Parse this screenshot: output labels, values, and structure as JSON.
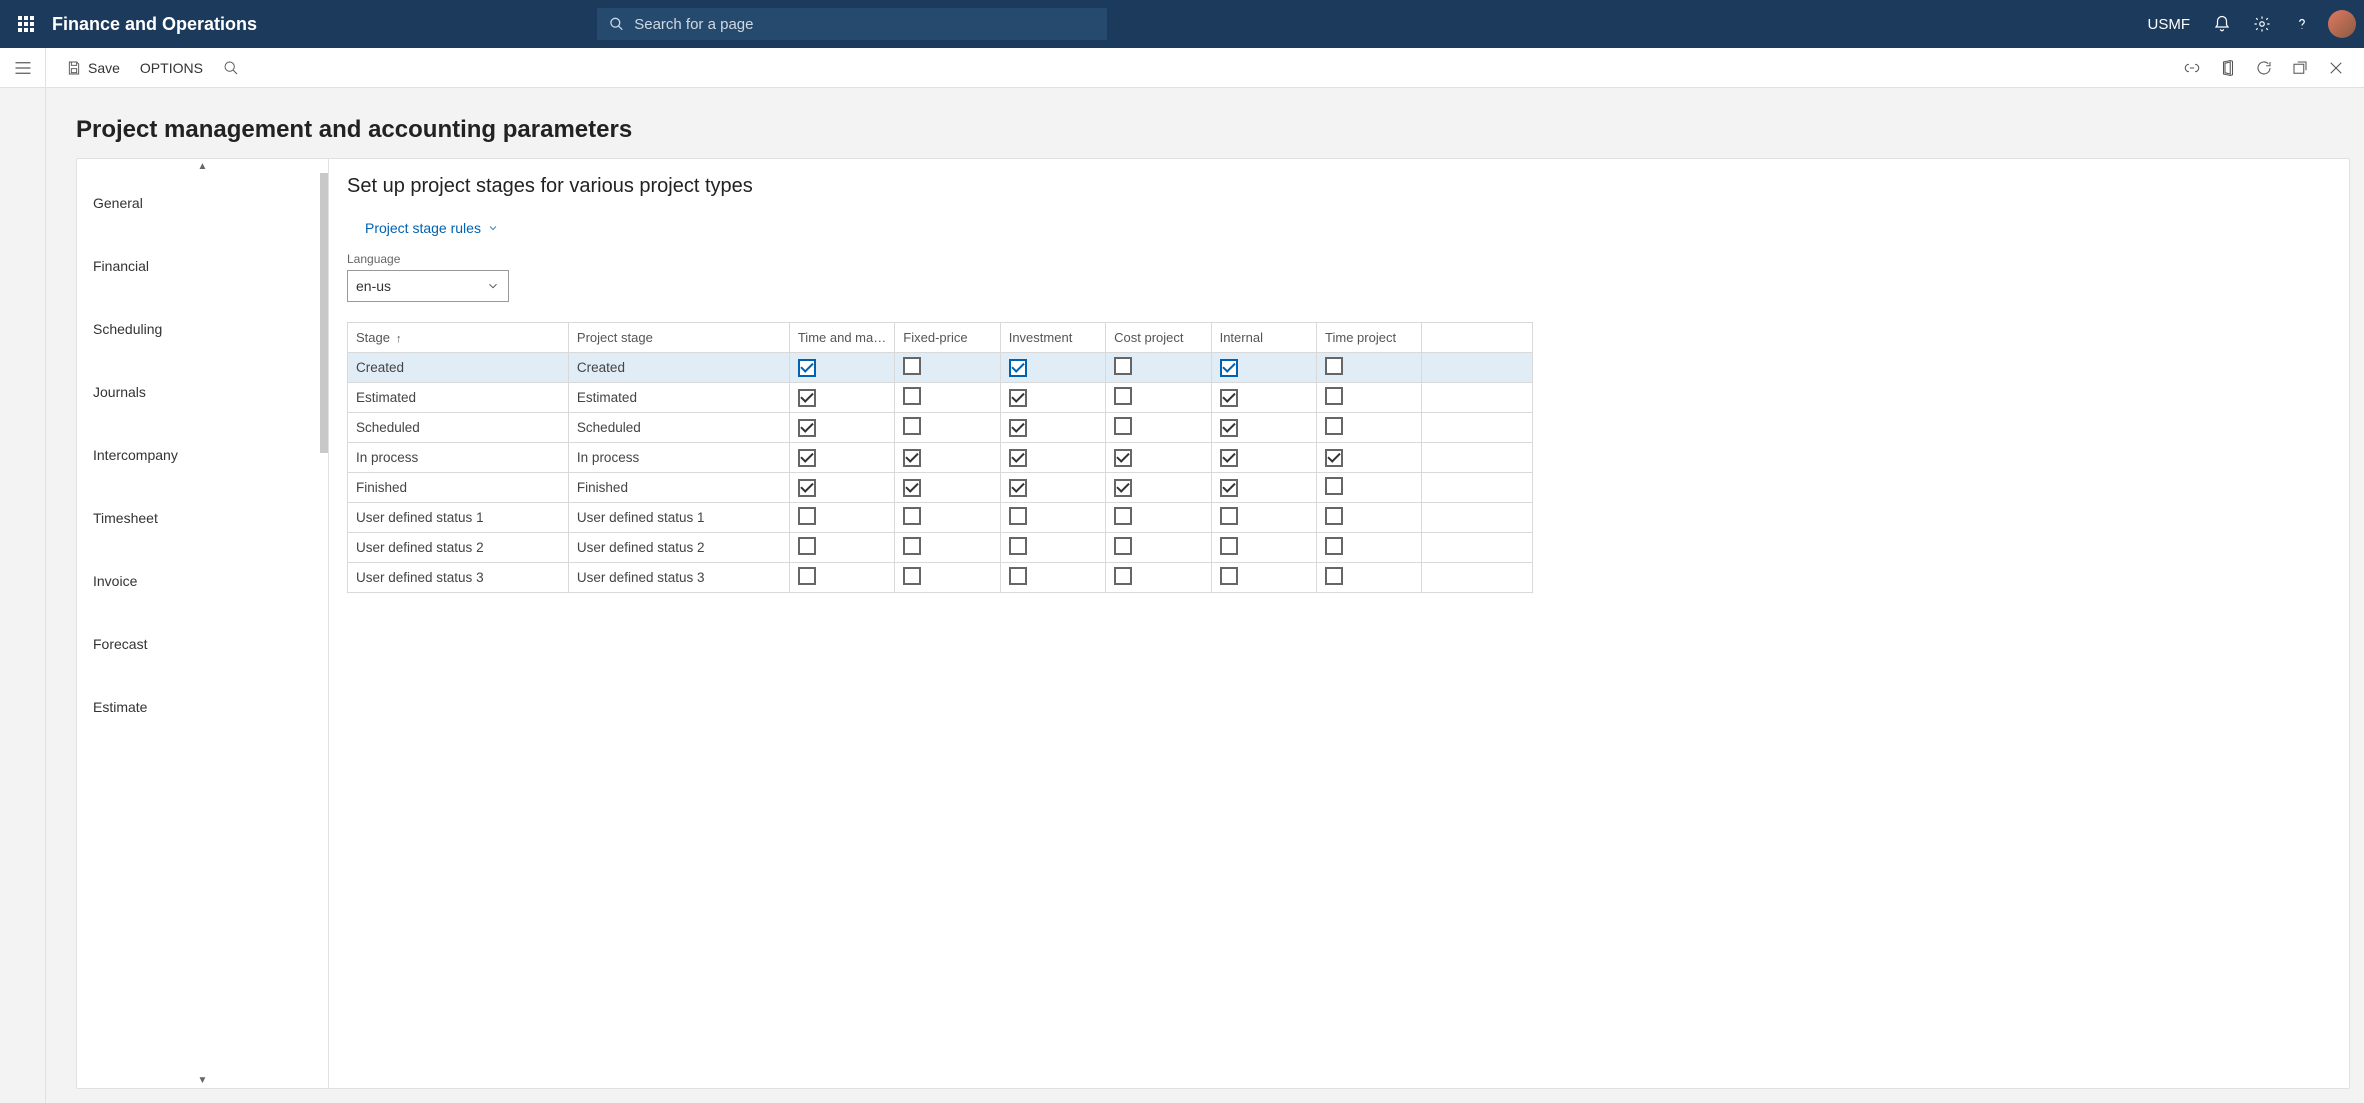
{
  "app": {
    "brand": "Finance and Operations"
  },
  "search": {
    "placeholder": "Search for a page"
  },
  "company": "USMF",
  "actions": {
    "save": "Save",
    "options": "OPTIONS"
  },
  "page": {
    "title": "Project management and accounting parameters"
  },
  "sidenav": {
    "items": [
      "General",
      "Financial",
      "Scheduling",
      "Journals",
      "Intercompany",
      "Timesheet",
      "Invoice",
      "Forecast",
      "Estimate"
    ],
    "selected_index": 0
  },
  "panel": {
    "title": "Set up project stages for various project types",
    "rules_link": "Project stage rules",
    "language_label": "Language",
    "language_value": "en-us"
  },
  "table": {
    "columns": [
      "Stage",
      "Project stage",
      "Time and materi...",
      "Fixed-price",
      "Investment",
      "Cost project",
      "Internal",
      "Time project"
    ],
    "sort_col": 0,
    "sort_dir": "asc",
    "selected_row": 0,
    "rows": [
      {
        "stage": "Created",
        "project_stage": "Created",
        "checks": [
          true,
          false,
          true,
          false,
          true,
          false
        ]
      },
      {
        "stage": "Estimated",
        "project_stage": "Estimated",
        "checks": [
          true,
          false,
          true,
          false,
          true,
          false
        ]
      },
      {
        "stage": "Scheduled",
        "project_stage": "Scheduled",
        "checks": [
          true,
          false,
          true,
          false,
          true,
          false
        ]
      },
      {
        "stage": "In process",
        "project_stage": "In process",
        "checks": [
          true,
          true,
          true,
          true,
          true,
          true
        ]
      },
      {
        "stage": "Finished",
        "project_stage": "Finished",
        "checks": [
          true,
          true,
          true,
          true,
          true,
          false
        ]
      },
      {
        "stage": "User defined status 1",
        "project_stage": "User defined status 1",
        "checks": [
          false,
          false,
          false,
          false,
          false,
          false
        ]
      },
      {
        "stage": "User defined status 2",
        "project_stage": "User defined status 2",
        "checks": [
          false,
          false,
          false,
          false,
          false,
          false
        ]
      },
      {
        "stage": "User defined status 3",
        "project_stage": "User defined status 3",
        "checks": [
          false,
          false,
          false,
          false,
          false,
          false
        ]
      }
    ]
  }
}
